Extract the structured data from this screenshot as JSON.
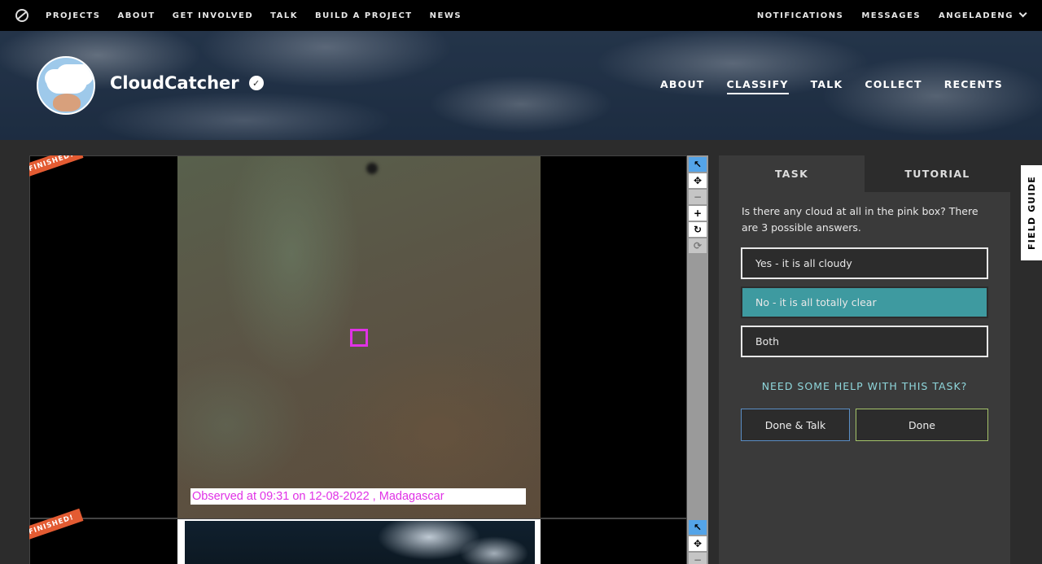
{
  "topnav": {
    "left": [
      "PROJECTS",
      "ABOUT",
      "GET INVOLVED",
      "TALK",
      "BUILD A PROJECT",
      "NEWS"
    ],
    "right": [
      "NOTIFICATIONS",
      "MESSAGES",
      "ANGELADENG"
    ]
  },
  "project": {
    "title": "CloudCatcher",
    "nav": [
      "ABOUT",
      "CLASSIFY",
      "TALK",
      "COLLECT",
      "RECENTS"
    ],
    "active_nav": "CLASSIFY"
  },
  "subjects": [
    {
      "badge": "FINISHED!",
      "caption": "Observed at 09:31 on 12-08-2022 , Madagascar"
    },
    {
      "badge": "FINISHED!"
    }
  ],
  "toolbar": {
    "icons": [
      "pointer-icon",
      "move-icon",
      "zoom-out-icon",
      "zoom-in-icon",
      "rotate-icon",
      "reset-icon"
    ]
  },
  "task_panel": {
    "tabs": [
      "TASK",
      "TUTORIAL"
    ],
    "question": "Is there any cloud at all in the pink box? There are 3 possible answers.",
    "answers": [
      "Yes - it is all cloudy",
      "No - it is all totally clear",
      "Both"
    ],
    "selected_answer": "No - it is all totally clear",
    "help": "NEED SOME HELP WITH THIS TASK?",
    "done_talk": "Done & Talk",
    "done": "Done"
  },
  "field_guide": "FIELD GUIDE",
  "colors": {
    "accent_selected": "#3e9aa0",
    "pink_box": "#e032e6",
    "badge": "#e35b32",
    "help_text": "#8fd7dc"
  }
}
